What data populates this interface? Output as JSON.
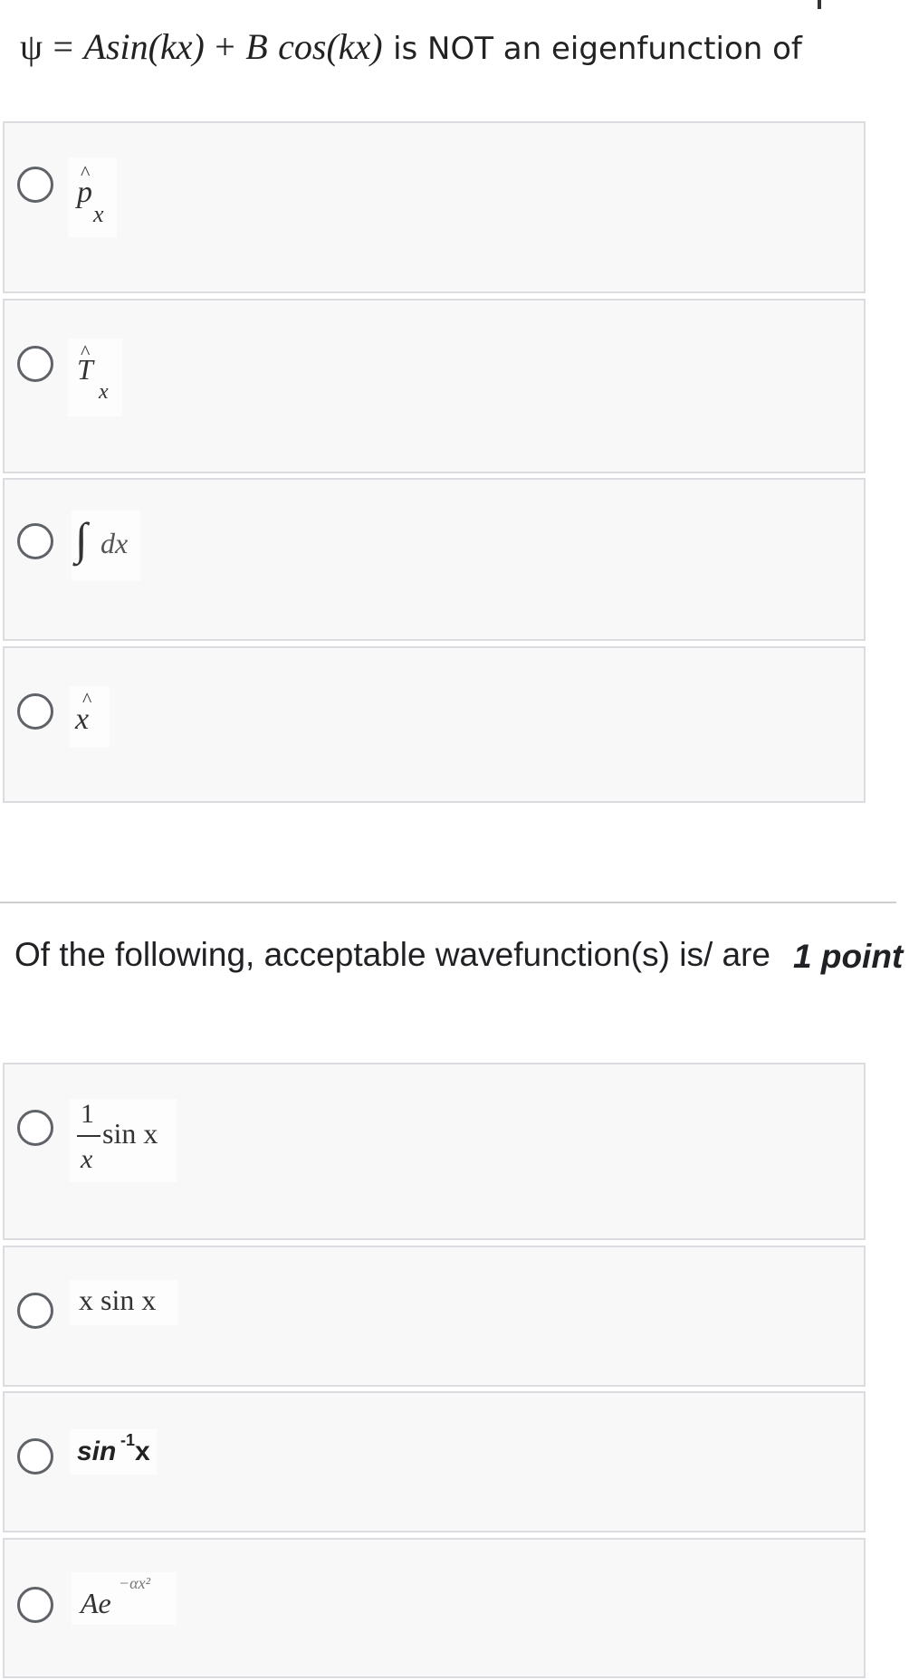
{
  "question1": {
    "psi": "ψ",
    "eq": "=",
    "a_term": "Asin(kx)",
    "plus": "+",
    "b": "B",
    "cos_term": "cos(kx)",
    "stem": "is NOT an eigenfunction of",
    "options": [
      {
        "symbol": "p",
        "hat": "^",
        "sub": "x"
      },
      {
        "symbol": "T",
        "hat": "^",
        "sub": "x"
      },
      {
        "integral": "∫",
        "text": "dx"
      },
      {
        "symbol": "x",
        "hat": "^"
      }
    ]
  },
  "question2": {
    "title": "Of the following, acceptable wavefunction(s) is/ are",
    "points": "1 point",
    "options": [
      {
        "numerator": "1",
        "denominator": "x",
        "func": "sin x"
      },
      {
        "text": "x sin x"
      },
      {
        "base": "sin",
        "sup": "-1",
        "arg": "x"
      },
      {
        "base": "Ae",
        "sup": "−αx²"
      }
    ]
  }
}
